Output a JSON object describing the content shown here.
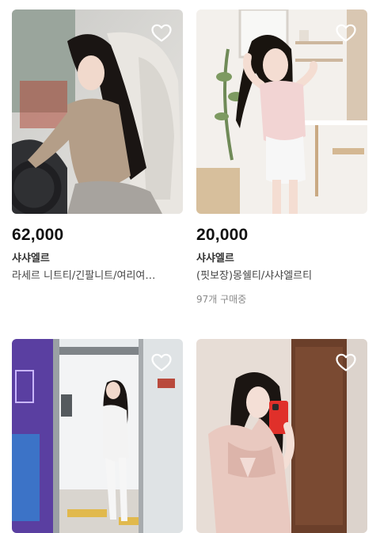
{
  "products": [
    {
      "price": "62,000",
      "shop": "샤샤엘르",
      "name": "라세르 니트티/긴팔니트/여리여…",
      "buyers": "",
      "heart_icon": "heart-outline-icon"
    },
    {
      "price": "20,000",
      "shop": "샤샤엘르",
      "name": "(핏보장)몽쉘티/샤샤엘르티",
      "buyers": "97개 구매중",
      "heart_icon": "heart-outline-icon"
    },
    {
      "heart_icon": "heart-outline-icon"
    },
    {
      "heart_icon": "heart-outline-icon"
    }
  ],
  "colors": {
    "price": "#111111",
    "shop": "#333333",
    "name": "#444444",
    "buyers": "#8a8a8a"
  }
}
